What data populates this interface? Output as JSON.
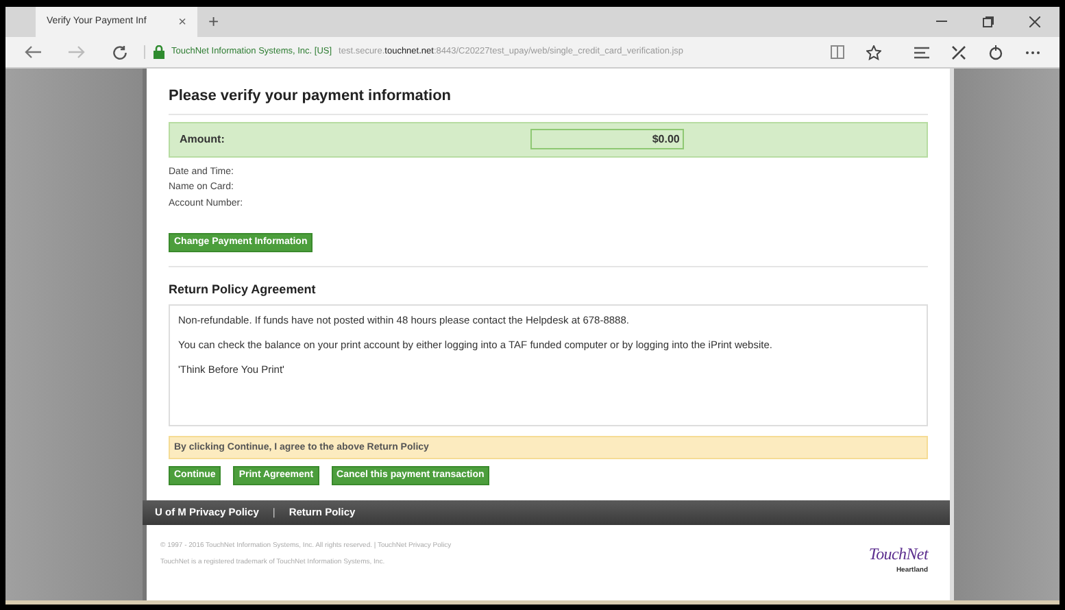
{
  "browser": {
    "tab_title": "Verify Your Payment Inf",
    "tab_close": "×",
    "new_tab": "+",
    "site_identity": "TouchNet Information Systems, Inc. [US]",
    "url_prefix": "test.secure.",
    "url_domain": "touchnet.net",
    "url_path": ":8443/C20227test_upay/web/single_credit_card_verification.jsp"
  },
  "page": {
    "title": "Please verify your payment information",
    "amount": {
      "label": "Amount:",
      "value": "$0.00"
    },
    "details": [
      "Date and Time:",
      "Name on Card:",
      "Account Number:"
    ],
    "change_button": "Change Payment Information",
    "policy_title": "Return Policy Agreement",
    "policy_paragraphs": [
      "Non-refundable. If funds have not posted within 48 hours please contact the Helpdesk at 678-8888.",
      "You can check the balance on your print account by either logging into a TAF funded computer or by logging into the iPrint website.",
      "'Think Before You Print'"
    ],
    "agreement_notice": "By clicking Continue, I agree to the above Return Policy",
    "actions": [
      "Continue",
      "Print Agreement",
      "Cancel this payment transaction"
    ]
  },
  "footer": {
    "links": [
      "U of M Privacy Policy",
      "Return Policy"
    ],
    "separator": "|",
    "copyright": [
      "© 1997 - 2016 TouchNet Information Systems, Inc. All rights reserved. | TouchNet Privacy Policy",
      "TouchNet is a registered trademark of TouchNet Information Systems, Inc."
    ],
    "logo": {
      "name": "TouchNet",
      "tagline": "Heartland"
    }
  }
}
